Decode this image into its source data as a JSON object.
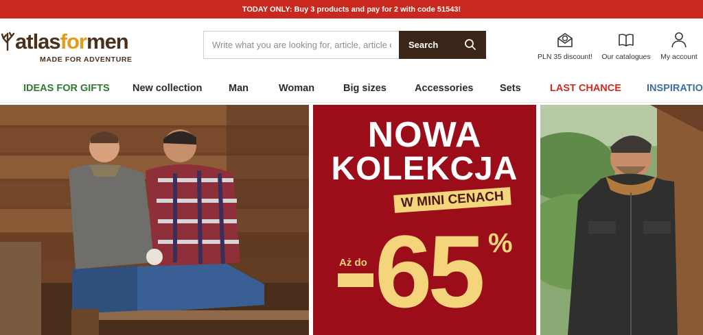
{
  "promo": {
    "text": "TODAY ONLY: Buy 3 products and pay for 2 with code 51543!"
  },
  "logo": {
    "word_a": "atlas",
    "word_b": "for",
    "word_c": "men",
    "tagline": "MADE FOR ADVENTURE"
  },
  "search": {
    "placeholder": "Write what you are looking for, article, article code",
    "button_label": "Search"
  },
  "header_links": {
    "discount": "PLN 35 discount!",
    "catalogues": "Our catalogues",
    "account": "My account"
  },
  "nav": [
    {
      "label": "IDEAS FOR GIFTS",
      "color": "#2e7a32"
    },
    {
      "label": "New collection",
      "color": "#2b2b2b"
    },
    {
      "label": "Man",
      "color": "#2b2b2b"
    },
    {
      "label": "Woman",
      "color": "#2b2b2b"
    },
    {
      "label": "Big sizes",
      "color": "#2b2b2b"
    },
    {
      "label": "Accessories",
      "color": "#2b2b2b"
    },
    {
      "label": "Sets",
      "color": "#2b2b2b"
    },
    {
      "label": "LAST CHANCE",
      "color": "#d5281e"
    },
    {
      "label": "INSPIRATIONS",
      "color": "#3b6ea5"
    }
  ],
  "promo_banner": {
    "line1": "NOWA",
    "line2": "KOLEKCJA",
    "tag": "W MINI CENACH",
    "prefix": "Aż do",
    "value": "65",
    "percent": "%"
  },
  "colors": {
    "promo_bar": "#c8281e",
    "brand_brown": "#4a2f1d",
    "brand_orange": "#e49a18",
    "banner_red": "#9c0d1a",
    "banner_yellow": "#f4d57c"
  }
}
